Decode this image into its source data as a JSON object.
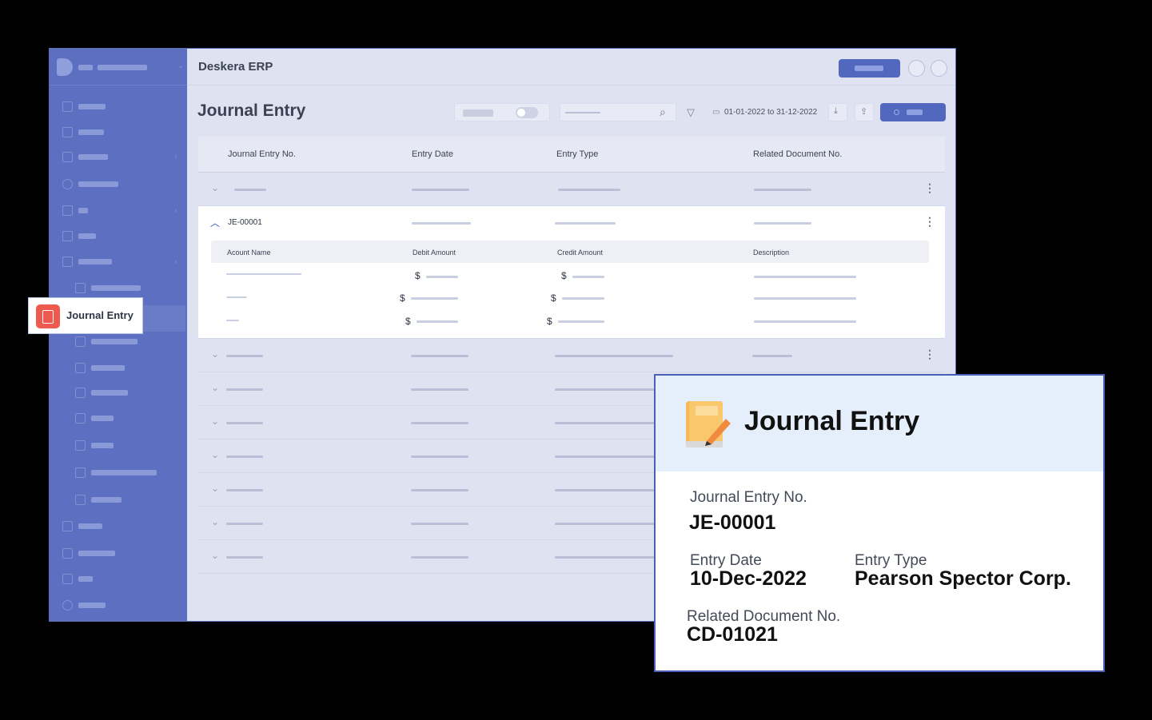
{
  "window": {
    "app_title": "Deskera ERP",
    "page_title": "Journal Entry"
  },
  "toolbar": {
    "date_from": "01-01-2022",
    "date_sep": "to",
    "date_to": "31-12-2022"
  },
  "table": {
    "headers": [
      "Journal Entry No.",
      "Entry Date",
      "Entry Type",
      "Related Document No."
    ],
    "expanded_row": {
      "id": "JE-00001",
      "sub_headers": [
        "Acount Name",
        "Debit Amount",
        "Credit Amount",
        "Description"
      ],
      "currency": "$"
    }
  },
  "sidebar": {
    "selected_item": "Journal Entry"
  },
  "card": {
    "title": "Journal Entry",
    "jeno_label": "Journal Entry No.",
    "jeno_value": "JE-00001",
    "date_label": "Entry Date",
    "date_value": "10-Dec-2022",
    "type_label": "Entry Type",
    "type_value": "Pearson Spector Corp.",
    "doc_label": "Related Document No.",
    "doc_value": "CD-01021"
  },
  "colors": {
    "sidebar": "#5c6fc0",
    "accent": "#5268bf",
    "callout_icon": "#ee5a4f",
    "card_border": "#4b5fb8"
  },
  "icons": [
    "logo-icon",
    "search-icon",
    "filter-icon",
    "calendar-icon",
    "download-icon",
    "share-icon",
    "bell-icon",
    "user-icon",
    "journal-icon",
    "notebook-pencil-icon"
  ]
}
